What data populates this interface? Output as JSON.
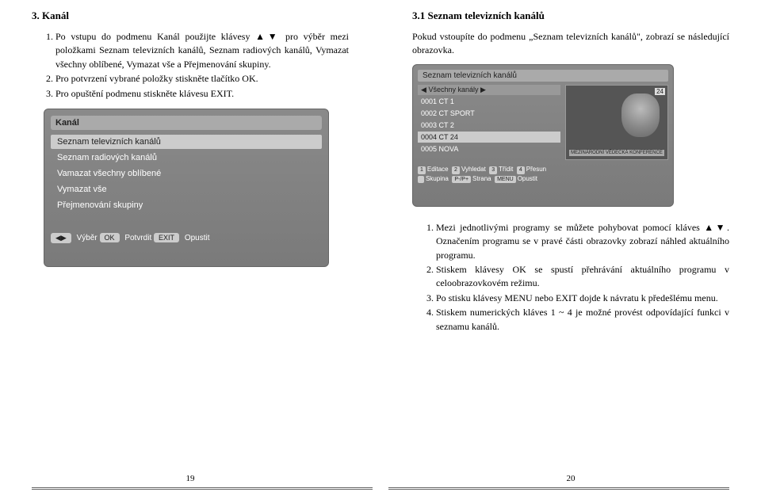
{
  "left": {
    "heading": "3. Kanál",
    "list": [
      "Po vstupu do podmenu Kanál použijte klávesy ▲▼ pro výběr mezi položkami Seznam televizních kanálů, Seznam radiových kanálů, Vymazat všechny oblíbené, Vymazat vše a Přejmenování skupiny.",
      "Pro potvrzení vybrané položky stiskněte tlačítko OK.",
      "Pro opuštění podmenu stiskněte klávesu EXIT."
    ],
    "fig": {
      "title": "Kanál",
      "items": [
        "Seznam televizních kanálů",
        "Seznam radiových kanálů",
        "Vamazat všechny oblíbené",
        "Vymazat vše",
        "Přejmenování skupiny"
      ],
      "bottom": [
        "Výběr",
        "Potvrdit",
        "Opustit"
      ],
      "bottom_icons": [
        "◀▶",
        "OK",
        "EXIT"
      ]
    },
    "page_num": "19"
  },
  "right": {
    "heading": "3.1 Seznam televizních kanálů",
    "intro": "Pokud vstoupíte do podmenu „Seznam televizních kanálů\", zobrazí se následující obrazovka.",
    "fig": {
      "title": "Seznam televizních kanálů",
      "tab": "Všechny kanály",
      "channels": [
        "0001 CT 1",
        "0002 CT SPORT",
        "0003 CT 2",
        "0004 CT 24",
        "0005 NOVA"
      ],
      "preview_badge": "24",
      "preview_caption": "MEZINÁRODNÍ VĚDECKÁ KONFERENCE",
      "legend_row1": [
        "1",
        "Editace",
        "2",
        "Vyhledat",
        "3",
        "Třídit",
        "4",
        "Přesun"
      ],
      "legend_row2": [
        "",
        "Skupina",
        "P-/P+",
        "Strana",
        "MENU",
        "Opustit"
      ]
    },
    "list": [
      "Mezi jednotlivými programy se můžete pohybovat pomocí kláves ▲▼. Označením programu se v pravé části obrazovky zobrazí náhled aktuálního programu.",
      "Stiskem klávesy OK se spustí přehrávání aktuálního programu v celoobrazovkovém režimu.",
      "Po stisku klávesy MENU nebo EXIT dojde k návratu k předešlému menu.",
      "Stiskem numerických kláves 1 ~ 4 je možné provést odpovídající funkci v seznamu kanálů."
    ],
    "page_num": "20"
  }
}
